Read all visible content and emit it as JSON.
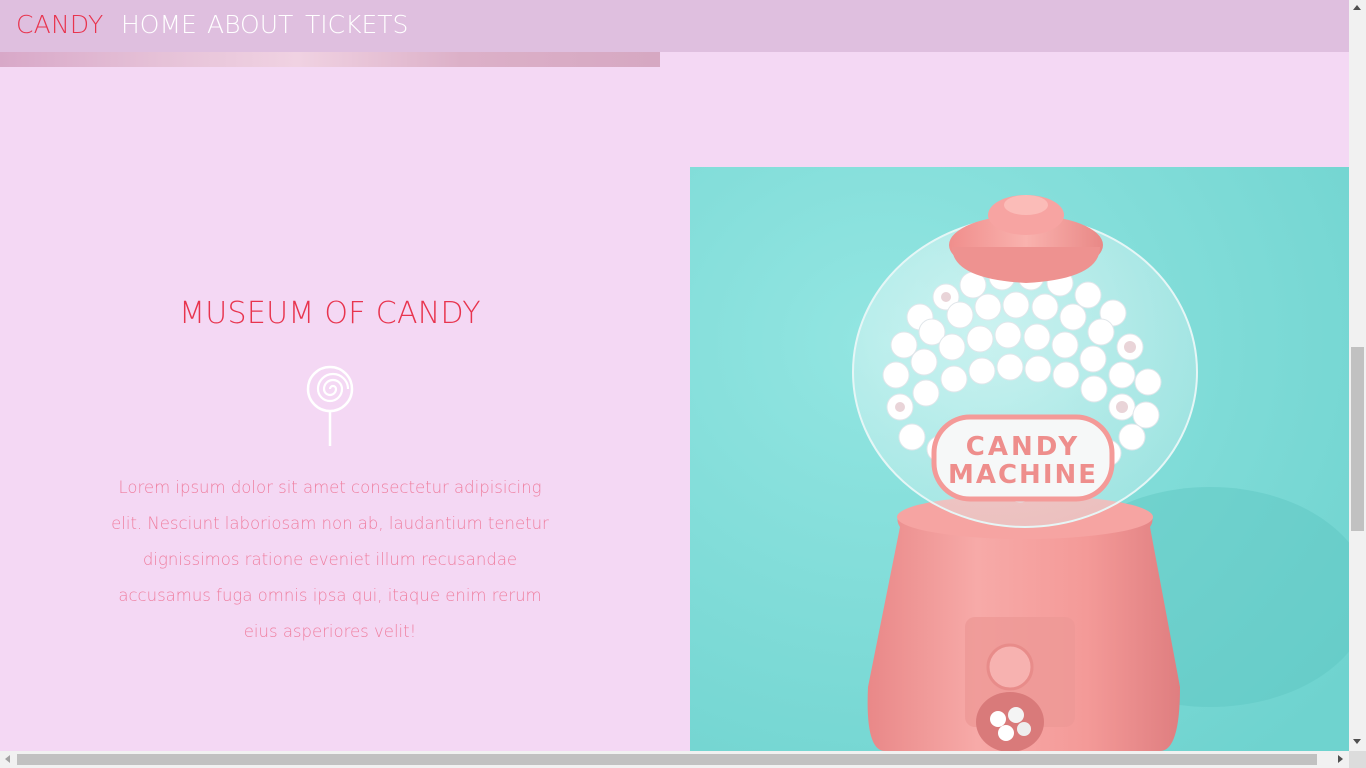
{
  "nav": {
    "brand": "CANDY",
    "links": [
      "HOME",
      "ABOUT",
      "TICKETS"
    ]
  },
  "museum": {
    "title": "MUSEUM OF CANDY",
    "icon": "lollipop-icon",
    "body": "Lorem ipsum dolor sit amet consectetur adipisicing elit. Nesciunt laboriosam non ab, laudantium tenetur dignissimos ratione eveniet illum recusandae accusamus fuga omnis ipsa qui, itaque enim rerum eius asperiores velit!"
  },
  "photo": {
    "label_line1": "CANDY",
    "label_line2": "MACHINE"
  },
  "colors": {
    "brand": "#e8344e",
    "nav_bg": "#dfbfdf",
    "page_bg": "#f4d8f4",
    "body_text": "#ef7fa0",
    "photo_bg": "#7edcd8",
    "machine_pink": "#f4a0a0"
  }
}
